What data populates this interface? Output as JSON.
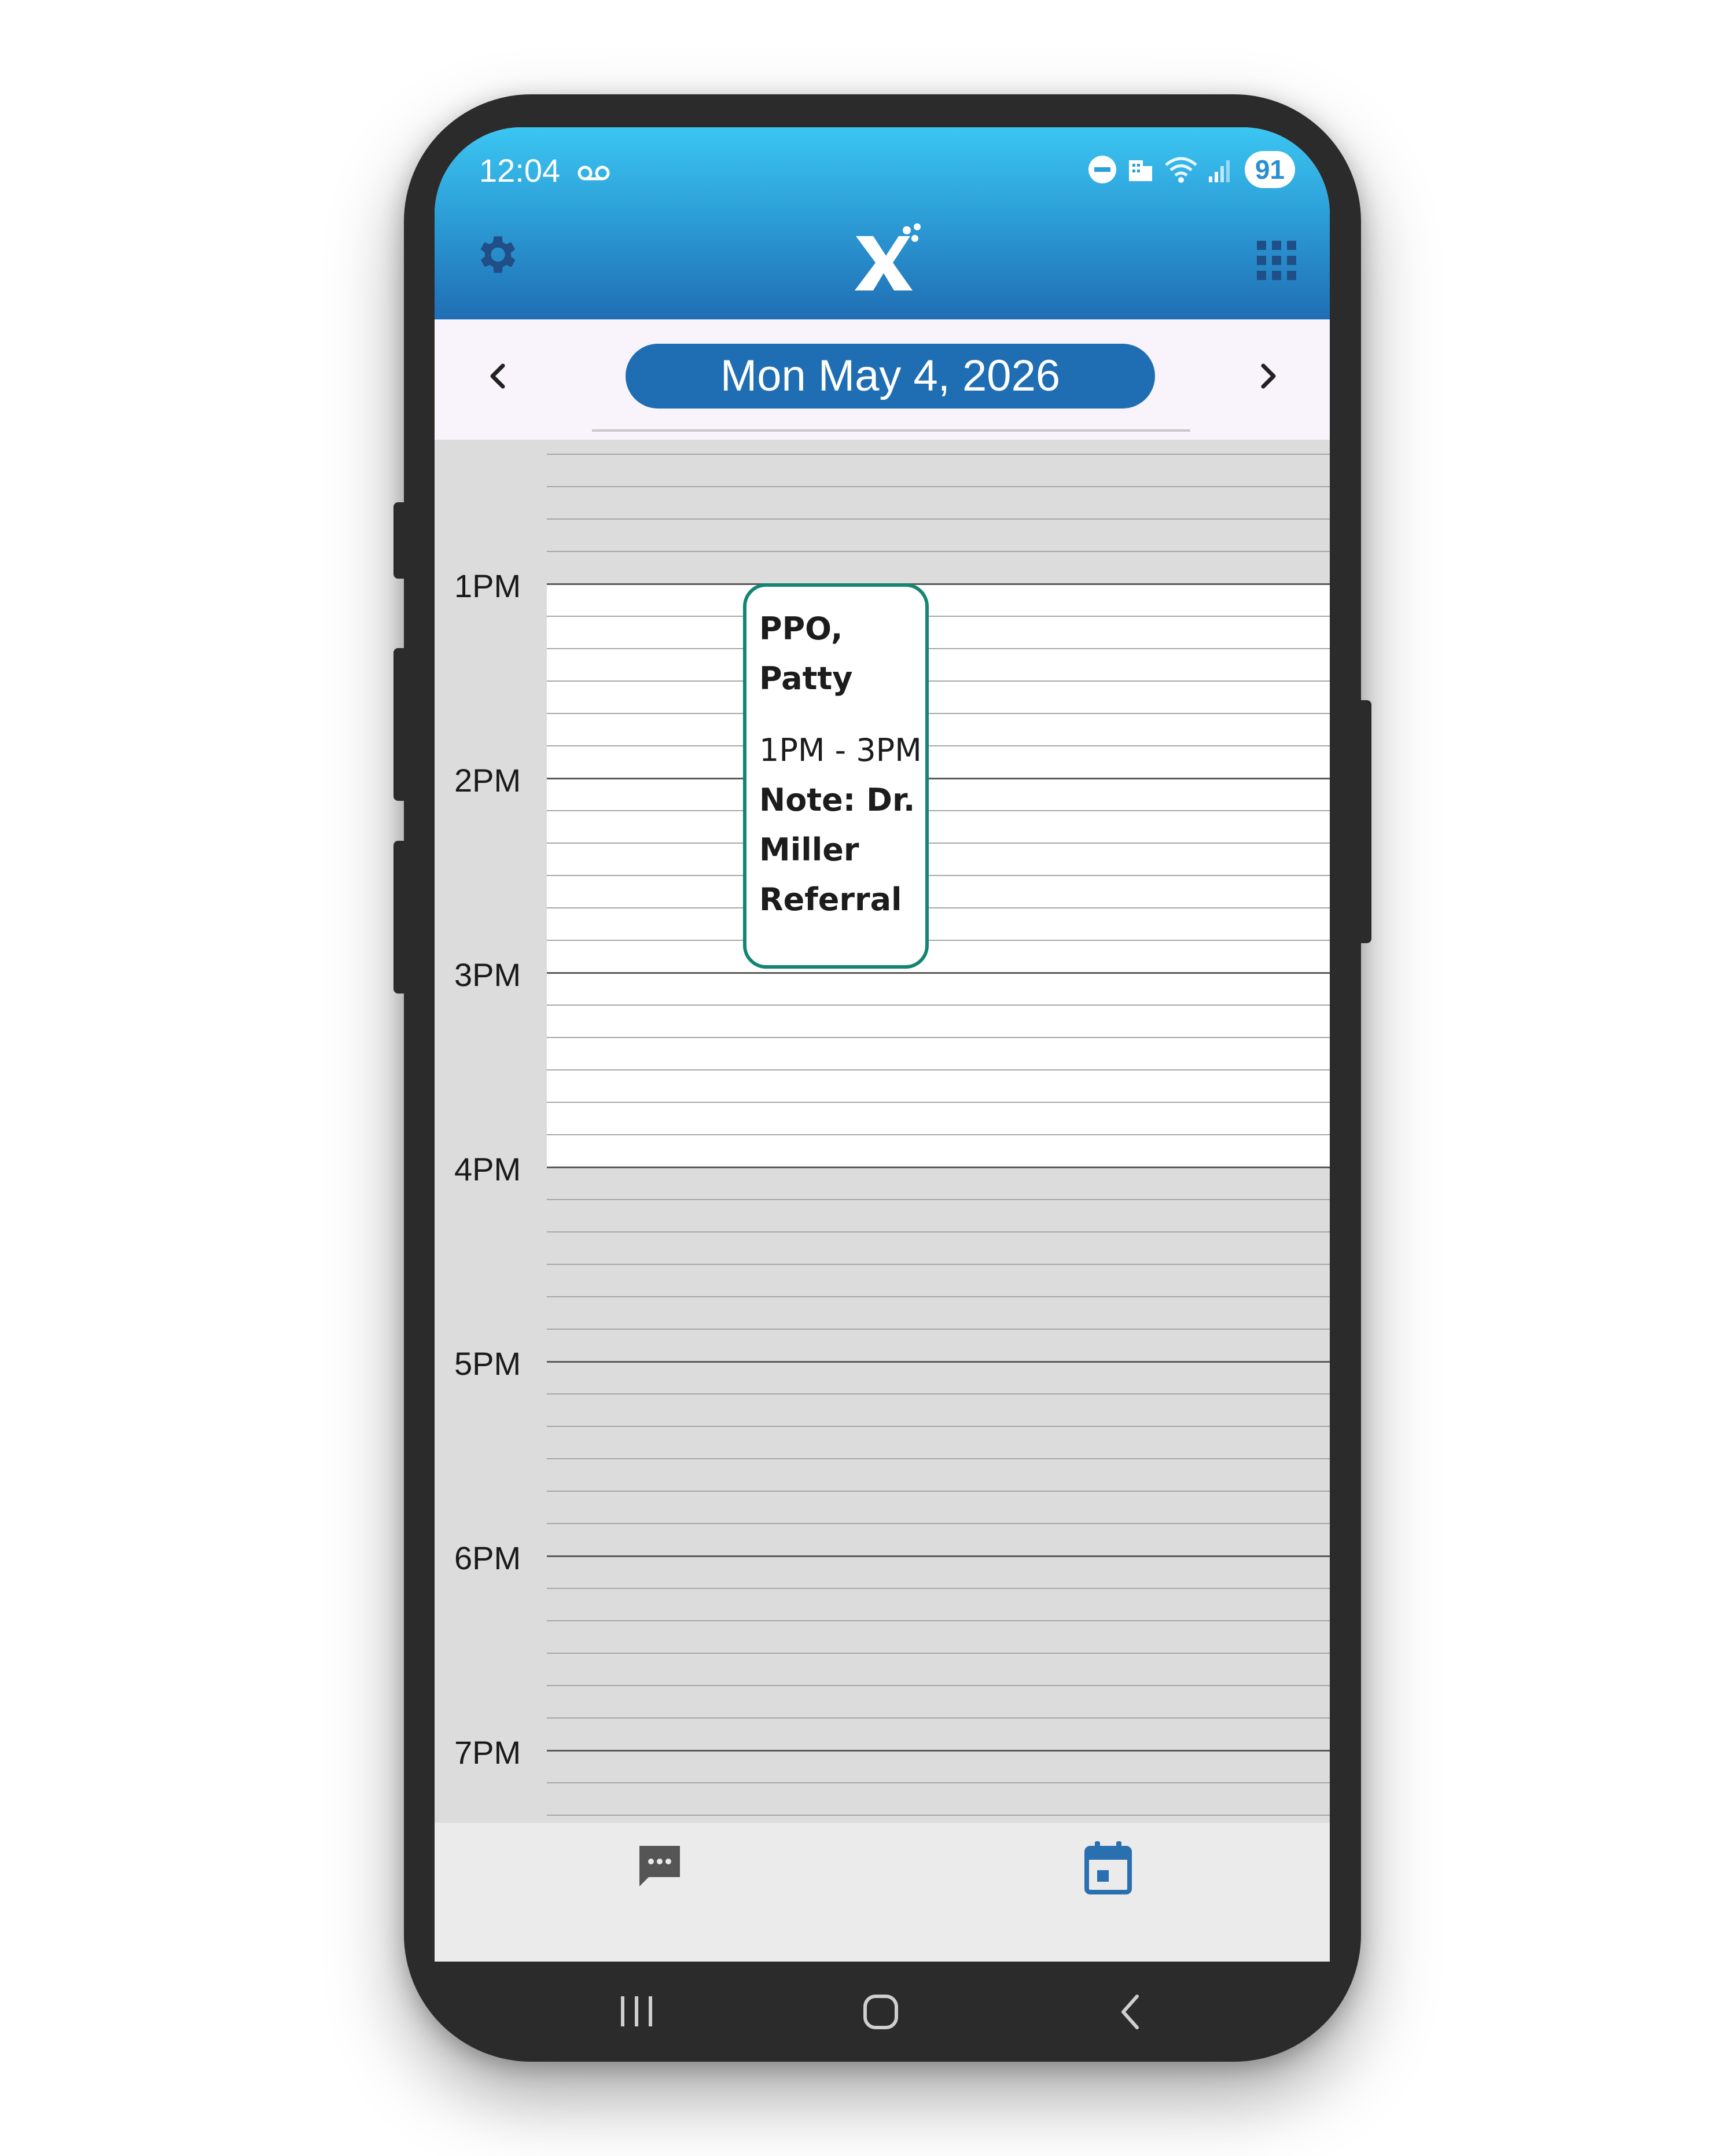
{
  "status_bar": {
    "time": "12:04",
    "battery": "91"
  },
  "header": {
    "settings_icon": "gear-icon",
    "logo_icon": "x-logo-icon",
    "apps_icon": "grid-icon"
  },
  "date_nav": {
    "date": "Mon May 4, 2026",
    "prev_icon": "chevron-left-icon",
    "next_icon": "chevron-right-icon"
  },
  "calendar": {
    "time_labels": [
      "1PM",
      "2PM",
      "3PM",
      "4PM",
      "5PM",
      "6PM",
      "7PM"
    ],
    "appointment": {
      "name": "PPO, Patty",
      "time": "1PM - 3PM",
      "note": "Note: Dr. Miller Referral",
      "border_color": "#138575"
    }
  },
  "bottom_nav": {
    "chat_icon": "chat-icon",
    "calendar_icon": "calendar-icon",
    "active_color": "#2a6fb0"
  },
  "colors": {
    "accent": "#1f6eb3",
    "header_top": "#3bc6f2"
  }
}
